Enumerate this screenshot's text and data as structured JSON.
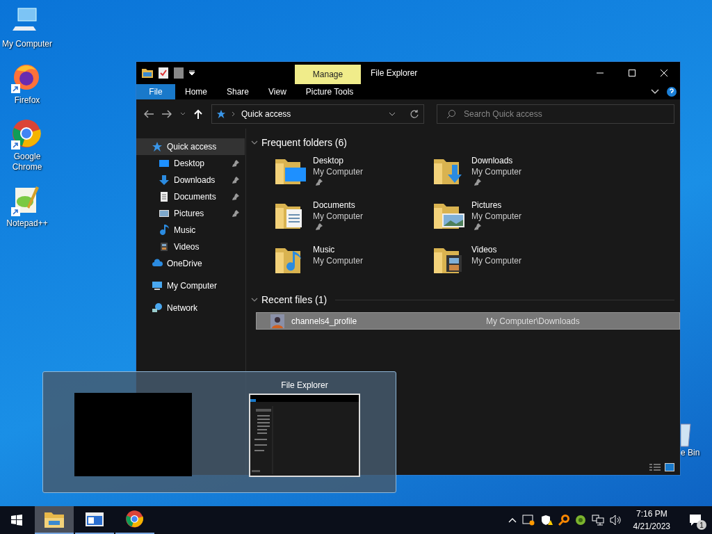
{
  "desktop_icons": [
    {
      "label": "My Computer",
      "kind": "computer",
      "shortcut": false
    },
    {
      "label": "Firefox",
      "kind": "firefox",
      "shortcut": true
    },
    {
      "label": "Google Chrome",
      "kind": "chrome",
      "shortcut": true
    },
    {
      "label": "Notepad++",
      "kind": "notepad",
      "shortcut": true
    }
  ],
  "recycle_bin": {
    "label": "e Bin"
  },
  "window": {
    "title": "File Explorer",
    "context_tab": "Manage",
    "ribbon_tabs": [
      {
        "label": "File",
        "selected": true
      },
      {
        "label": "Home",
        "selected": false
      },
      {
        "label": "Share",
        "selected": false
      },
      {
        "label": "View",
        "selected": false
      },
      {
        "label": "Picture Tools",
        "selected": false
      }
    ],
    "address": {
      "path": "Quick access"
    },
    "search": {
      "placeholder": "Search Quick access"
    },
    "sidebar": {
      "items": [
        {
          "label": "Quick access",
          "kind": "star",
          "selected": true,
          "children": [
            {
              "label": "Desktop",
              "kind": "desktop",
              "pinned": true,
              "selected": false
            },
            {
              "label": "Downloads",
              "kind": "download",
              "pinned": true,
              "selected": false
            },
            {
              "label": "Documents",
              "kind": "document",
              "pinned": true,
              "selected": false
            },
            {
              "label": "Pictures",
              "kind": "pictures",
              "pinned": true,
              "selected": false
            },
            {
              "label": "Music",
              "kind": "music",
              "pinned": false,
              "selected": false
            },
            {
              "label": "Videos",
              "kind": "video",
              "pinned": false,
              "selected": false
            }
          ]
        },
        {
          "label": "OneDrive",
          "kind": "cloud",
          "selected": false
        },
        {
          "label": "My Computer",
          "kind": "computer",
          "selected": false
        },
        {
          "label": "Network",
          "kind": "network",
          "selected": false
        }
      ]
    },
    "frequent_folders": {
      "title": "Frequent folders (6)",
      "expanded": true,
      "items": [
        {
          "name": "Desktop",
          "location": "My Computer",
          "kind": "desktop",
          "pinned": true
        },
        {
          "name": "Downloads",
          "location": "My Computer",
          "kind": "download",
          "pinned": true
        },
        {
          "name": "Documents",
          "location": "My Computer",
          "kind": "document",
          "pinned": true
        },
        {
          "name": "Pictures",
          "location": "My Computer",
          "kind": "pictures",
          "pinned": true
        },
        {
          "name": "Music",
          "location": "My Computer",
          "kind": "music",
          "pinned": false
        },
        {
          "name": "Videos",
          "location": "My Computer",
          "kind": "video",
          "pinned": false
        }
      ]
    },
    "recent_files": {
      "title": "Recent files (1)",
      "expanded": true,
      "items": [
        {
          "name": "channels4_profile",
          "location": "My Computer\\Downloads",
          "selected": true
        }
      ]
    }
  },
  "task_preview": {
    "title": "File Explorer"
  },
  "taskbar": {
    "apps": [
      {
        "kind": "explorer",
        "selected": true
      },
      {
        "kind": "window",
        "selected": false
      },
      {
        "kind": "chrome",
        "selected": false
      }
    ],
    "time": "7:16 PM",
    "date": "4/21/2023",
    "notifications": "1"
  }
}
